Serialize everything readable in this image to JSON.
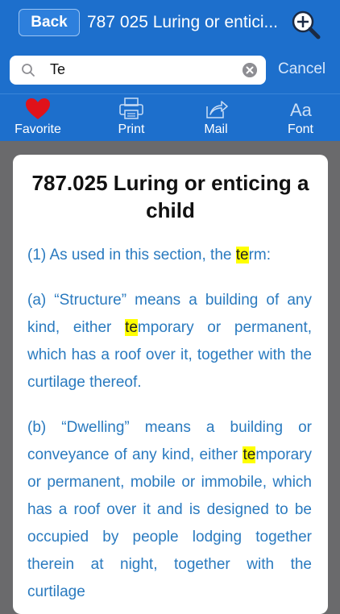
{
  "navbar": {
    "back_label": "Back",
    "title": "787 025 Luring or entici..."
  },
  "search": {
    "value": "Te",
    "cancel_label": "Cancel"
  },
  "toolbar": {
    "favorite_label": "Favorite",
    "print_label": "Print",
    "mail_label": "Mail",
    "font_label": "Font"
  },
  "document": {
    "title": "787.025 Luring or enticing a child",
    "p1": {
      "before": "(1) As used in this section, the ",
      "highlight": "te",
      "after": "rm:"
    },
    "p2": {
      "before": "(a) “Structure” means a building of any kind, either ",
      "highlight": "te",
      "after": "mporary or permanent, which has a roof over it, together with the curtilage thereof."
    },
    "p3": {
      "before": "(b) “Dwelling” means a building or conveyance of any kind, either ",
      "highlight": "te",
      "after": "mporary or permanent, mobile or immobile, which has a roof over it and is designed to be occupied by people lodging together therein at night, together with the curtilage"
    }
  },
  "colors": {
    "bar": "#1d6fcc",
    "body_text": "#2a7abf",
    "highlight": "#ffff00",
    "favorite_heart": "#e0121a"
  },
  "icons": [
    "zoom-in-icon",
    "search-icon",
    "clear-icon",
    "heart-icon",
    "printer-icon",
    "share-icon",
    "font-icon"
  ]
}
